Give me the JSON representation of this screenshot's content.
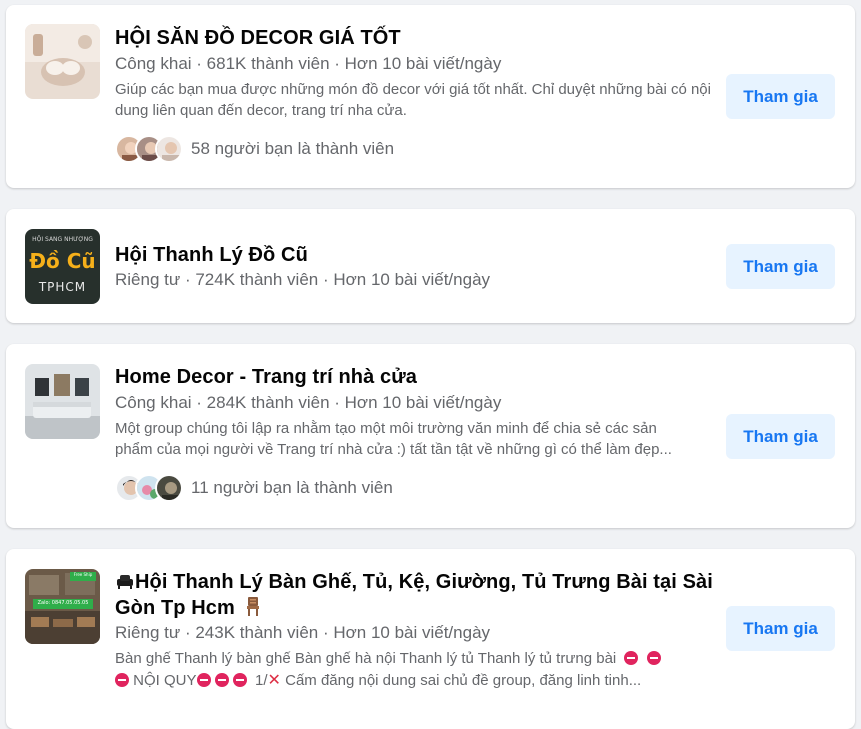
{
  "groups": [
    {
      "name": "HỘI SĂN ĐỒ DECOR GIÁ TỐT",
      "meta": "Công khai · 681K thành viên · Hơn 10 bài viết/ngày",
      "description": "Giúp các bạn mua được những món đồ decor với giá tốt nhất. Chỉ duyệt những bài có nội dung liên quan đến decor, trang trí nha cửa.",
      "friends": "58 người bạn là thành viên",
      "join_label": "Tham gia"
    },
    {
      "name": "Hội Thanh Lý Đồ Cũ",
      "meta": "Riêng tư · 724K thành viên · Hơn 10 bài viết/ngày",
      "join_label": "Tham gia",
      "thumb_text": {
        "top": "HỘI SANG NHƯỢNG",
        "main": "Đồ Cũ",
        "bottom": "TPHCM"
      }
    },
    {
      "name": "Home Decor - Trang trí nhà cửa",
      "meta": "Công khai · 284K thành viên · Hơn 10 bài viết/ngày",
      "description_line1": "Một group chúng tôi lập ra nhằm tạo một môi trường văn minh để chia sẻ các sản",
      "description_line2": "phẩm của mọi người về Trang trí nhà cửa :) tất tần tật về những gì có thể làm đẹp...",
      "friends": "11 người bạn là thành viên",
      "join_label": "Tham gia"
    },
    {
      "name_line1": "Hội Thanh Lý Bàn Ghế, Tủ, Kệ, Giường, Tủ Trưng Bài tại Sài",
      "name_line2": "Gòn Tp Hcm",
      "meta": "Riêng tư · 243K thành viên · Hơn 10 bài viết/ngày",
      "description_line1": "Bàn ghế Thanh lý bàn ghế Bàn ghế hà nội Thanh lý tủ Thanh lý tủ trưng bài",
      "description_line2_a": "NỘI QUY",
      "description_line2_b": "1/",
      "description_line2_c": "Cấm đăng nội dung sai chủ đề group, đăng linh tinh...",
      "join_label": "Tham gia",
      "thumb_text": {
        "tag": "Free Ship",
        "phone": "Zalo: 0847.05.05.05"
      }
    }
  ],
  "colors": {
    "accent": "#1877f2",
    "button_bg": "#e7f3ff",
    "secondary_text": "#65676b",
    "page_bg": "#f0f2f5",
    "no_entry": "#e0245e"
  }
}
